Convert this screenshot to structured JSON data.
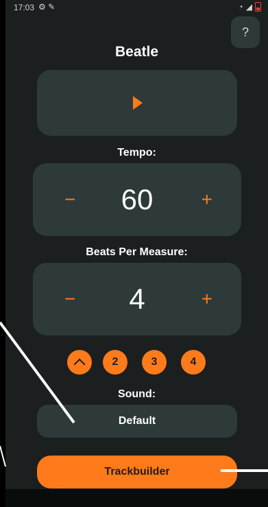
{
  "status": {
    "time": "17:03"
  },
  "help": {
    "label": "?"
  },
  "app": {
    "title": "Beatle"
  },
  "tempo": {
    "label": "Tempo:",
    "minus": "−",
    "value": "60",
    "plus": "+"
  },
  "beats_per_measure": {
    "label": "Beats Per Measure:",
    "minus": "−",
    "value": "4",
    "plus": "+"
  },
  "beat_buttons": [
    "2",
    "3",
    "4"
  ],
  "sound": {
    "label": "Sound:",
    "value": "Default"
  },
  "trackbuilder": {
    "label": "Trackbuilder"
  },
  "colors": {
    "accent": "#ff7a1a",
    "background": "#1b1f1f",
    "card": "#2e3939",
    "text": "#ffffff"
  }
}
